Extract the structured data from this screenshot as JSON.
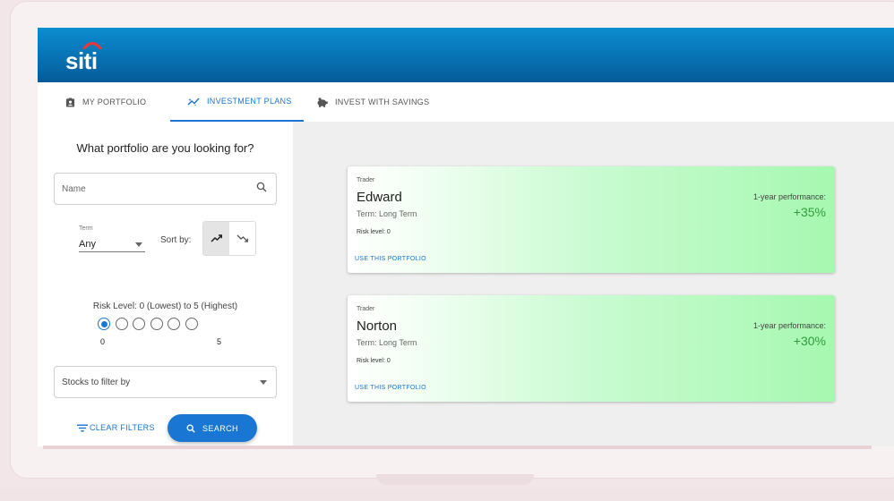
{
  "app": {
    "logo_text": "siti"
  },
  "tabs": [
    {
      "label": "MY PORTFOLIO"
    },
    {
      "label": "INVESTMENT PLANS"
    },
    {
      "label": "INVEST WITH SAVINGS"
    }
  ],
  "sidebar": {
    "title": "What portfolio are you looking for?",
    "name_placeholder": "Name",
    "term_label": "Term",
    "term_value": "Any",
    "sort_label": "Sort by:",
    "risk_title": "Risk Level: 0 (Lowest) to 5 (Highest)",
    "risk_selected": 0,
    "risk_min_label": "0",
    "risk_max_label": "5",
    "stocks_placeholder": "Stocks to filter by",
    "clear_label": "CLEAR FILTERS",
    "search_label": "SEARCH"
  },
  "cards": [
    {
      "role": "Trader",
      "name": "Edward",
      "term": "Term: Long Term",
      "risk": "Risk level: 0",
      "perf_label": "1-year performance:",
      "perf_value": "+35%",
      "action": "USE THIS PORTFOLIO"
    },
    {
      "role": "Trader",
      "name": "Norton",
      "term": "Term: Long Term",
      "risk": "Risk level: 0",
      "perf_label": "1-year performance:",
      "perf_value": "+30%",
      "action": "USE THIS PORTFOLIO"
    }
  ],
  "colors": {
    "header": "#0872b3",
    "accent": "#1976d2",
    "logo_arc": "#e53935",
    "positive": "#2e9e3a"
  }
}
